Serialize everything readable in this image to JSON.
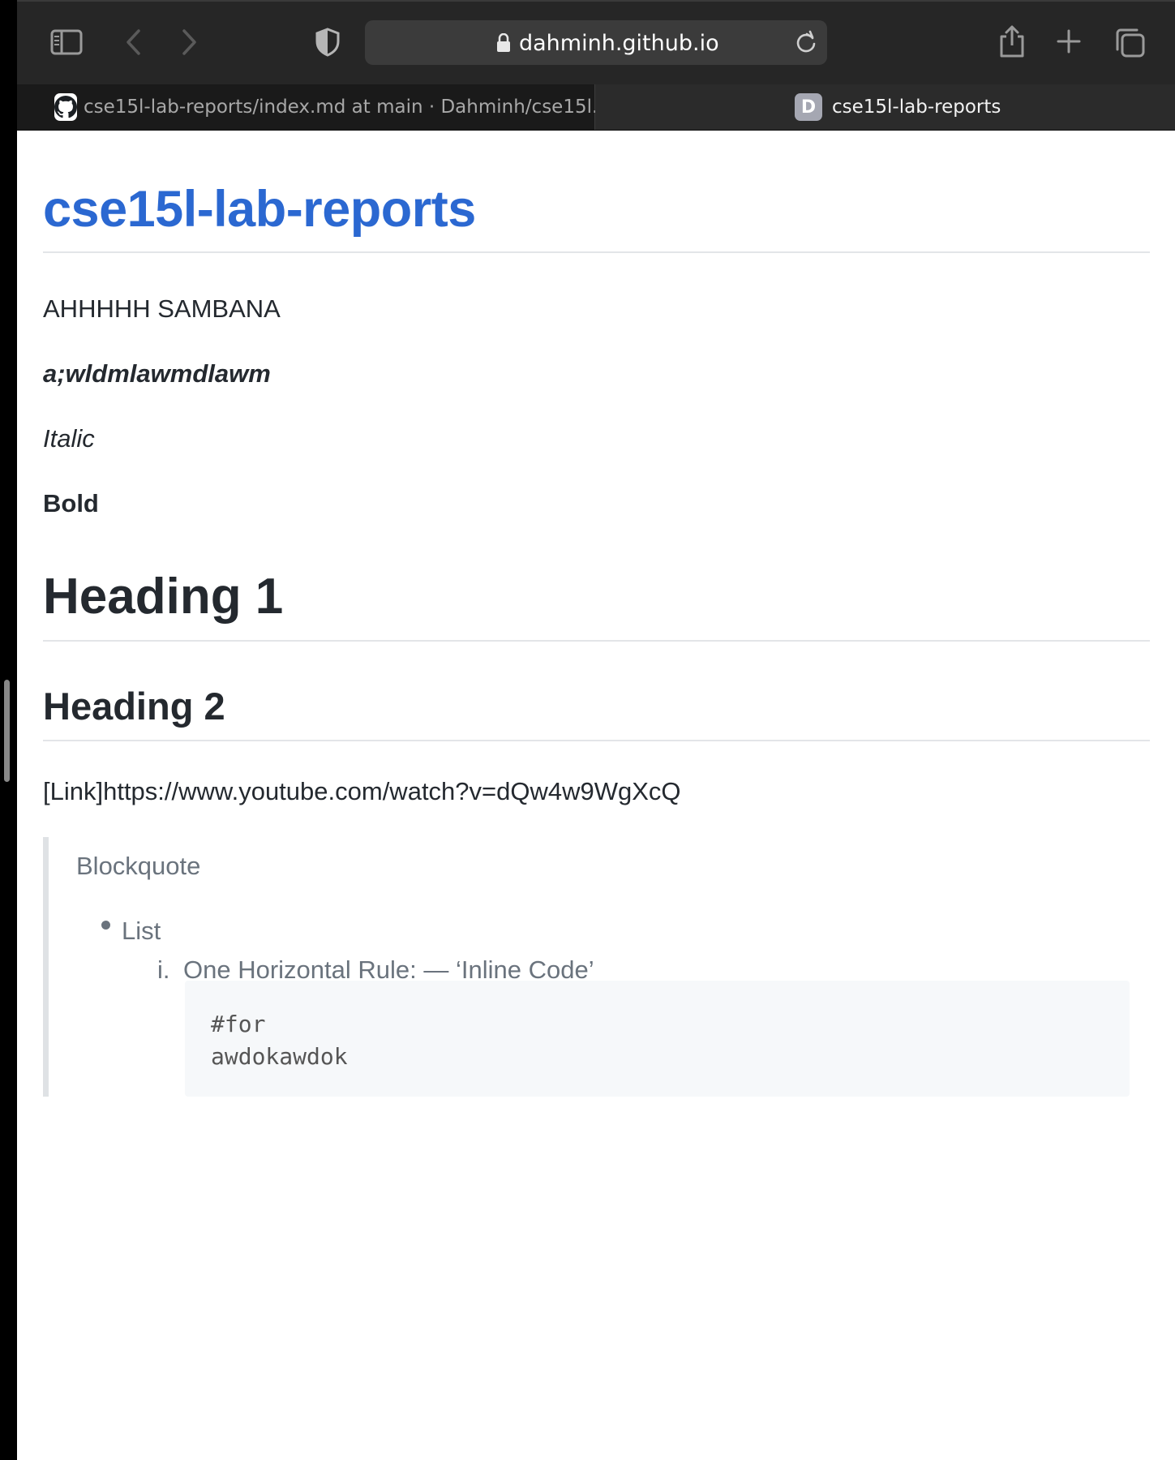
{
  "browser": {
    "address": "dahminh.github.io",
    "tabs": [
      {
        "label": "cse15l-lab-reports/index.md at main · Dahminh/cse15l...",
        "favicon": "github-icon",
        "active": false
      },
      {
        "label": "cse15l-lab-reports",
        "favicon_letter": "D",
        "active": true
      }
    ],
    "icons": [
      "sidebar-icon",
      "back-icon",
      "forward-icon",
      "shield-icon",
      "lock-icon",
      "reload-icon",
      "share-icon",
      "new-tab-icon",
      "tab-overview-icon"
    ]
  },
  "page": {
    "title": "cse15l-lab-reports",
    "para1": "AHHHHH SAMBANA",
    "para2": "a;wldmlawmdlawm",
    "para3": "Italic",
    "para4": "Bold",
    "heading1": "Heading 1",
    "heading2": "Heading 2",
    "link_line": "[Link]https://www.youtube.com/watch?v=dQw4w9WgXcQ",
    "blockquote": {
      "text": "Blockquote",
      "list_item": "List",
      "ordered_marker": "i.",
      "ordered_item": "One Horizontal Rule: — ‘Inline Code’",
      "code_lines": "#for\nawdokawdok"
    }
  },
  "colors": {
    "title": "#2b68d1",
    "toolbar": "#262626",
    "text": "#24292f",
    "quote_text": "#6a737d"
  }
}
